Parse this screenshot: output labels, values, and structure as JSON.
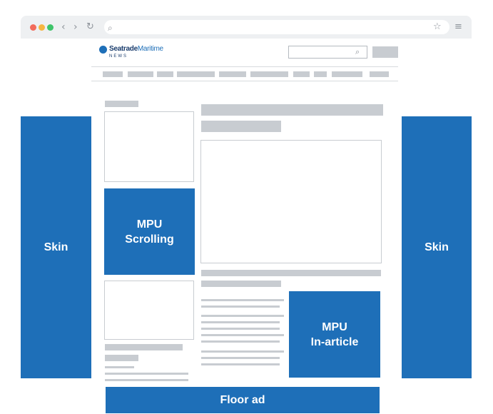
{
  "ads": {
    "skin_left": "Skin",
    "skin_right": "Skin",
    "mpu_scrolling": "MPU\nScrolling",
    "mpu_in_article": "MPU\nIn-article",
    "floor_ad": "Floor ad"
  },
  "site": {
    "logo_main": "Seatrade",
    "logo_accent": "Maritime",
    "logo_sub": "NEWS"
  },
  "icons": {
    "search": "search-icon",
    "star": "star-icon",
    "menu": "hamburger-menu-icon",
    "back": "chevron-left-icon",
    "forward": "chevron-right-icon",
    "reload": "reload-icon"
  },
  "colors": {
    "ad_blue": "#1e6fb8",
    "placeholder_grey": "#c8ccd1",
    "traffic_red": "#f26b5b",
    "traffic_yellow": "#f6b641",
    "traffic_green": "#3fc46a"
  }
}
